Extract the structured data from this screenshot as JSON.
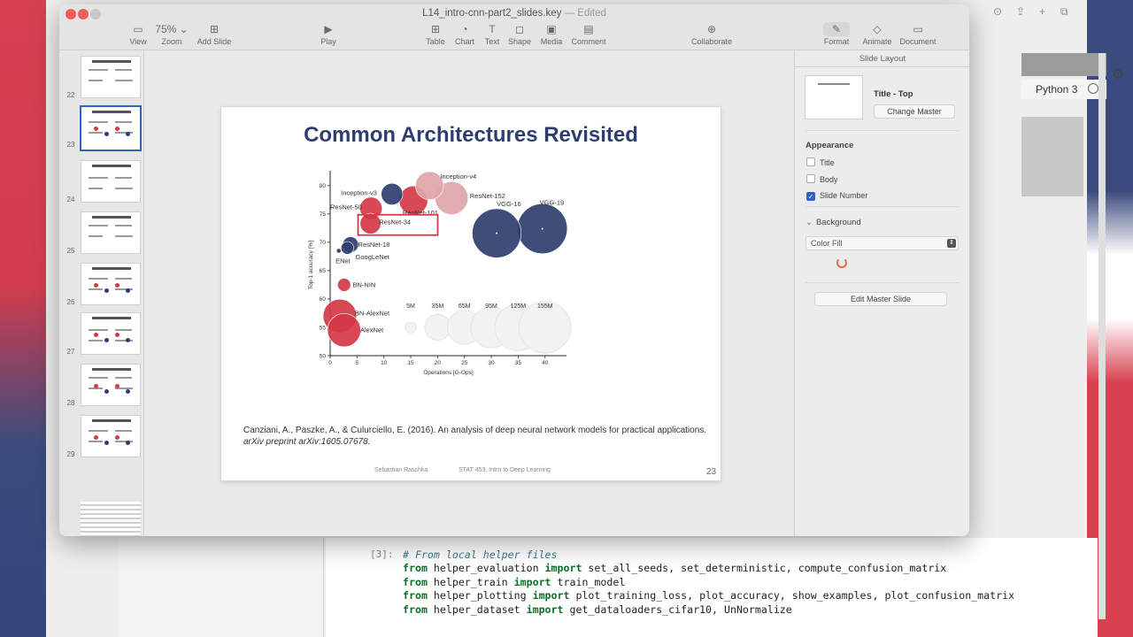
{
  "keynote": {
    "doc_title": "L14_intro-cnn-part2_slides.key",
    "doc_status": "— Edited",
    "toolbar": [
      {
        "name": "view",
        "icon": "▭",
        "label": "View"
      },
      {
        "name": "zoom",
        "icon": "75%  ⌄",
        "label": "Zoom"
      },
      {
        "name": "add-slide",
        "icon": "⊞",
        "label": "Add Slide"
      },
      {
        "name": "play",
        "icon": "▶",
        "label": "Play"
      },
      {
        "name": "table",
        "icon": "⊞",
        "label": "Table"
      },
      {
        "name": "chart",
        "icon": "◔",
        "label": "Chart"
      },
      {
        "name": "text",
        "icon": "T",
        "label": "Text"
      },
      {
        "name": "shape",
        "icon": "◻",
        "label": "Shape"
      },
      {
        "name": "media",
        "icon": "▣",
        "label": "Media"
      },
      {
        "name": "comment",
        "icon": "▤",
        "label": "Comment"
      },
      {
        "name": "collaborate",
        "icon": "⊕",
        "label": "Collaborate"
      },
      {
        "name": "format",
        "icon": "✎",
        "label": "Format"
      },
      {
        "name": "animate",
        "icon": "◇",
        "label": "Animate"
      },
      {
        "name": "document",
        "icon": "▭",
        "label": "Document"
      }
    ],
    "thumbnails": [
      "22",
      "23",
      "24",
      "25",
      "26",
      "27",
      "28",
      "29"
    ],
    "slide": {
      "title": "Common Architectures Revisited",
      "citation_plain": "Canziani, A., Paszke, A., & Culurciello, E. (2016). An analysis of deep neural network models for practical applications.",
      "citation_italic": "arXiv preprint arXiv:1605.07678.",
      "footer_left": "Sebastian Raschka",
      "footer_mid": "STAT 453: Intro to Deep Learning",
      "number": "23"
    },
    "inspector": {
      "header": "Slide Layout",
      "master_name": "Title - Top",
      "change_master": "Change Master",
      "appearance": "Appearance",
      "options": [
        {
          "label": "Title",
          "checked": false
        },
        {
          "label": "Body",
          "checked": false
        },
        {
          "label": "Slide Number",
          "checked": true
        }
      ],
      "background": "Background",
      "fill_type": "Color Fill",
      "edit_master": "Edit Master Slide"
    }
  },
  "jupyter": {
    "kernel": "Python 3",
    "prompt": "[3]:",
    "code": [
      "# From local helper files",
      "from helper_evaluation import set_all_seeds, set_deterministic, compute_confusion_matrix",
      "from helper_train import train_model",
      "from helper_plotting import plot_training_loss, plot_accuracy, show_examples, plot_confusion_matrix",
      "from helper_dataset import get_dataloaders_cifar10, UnNormalize"
    ]
  },
  "chart_data": {
    "type": "scatter",
    "xlabel": "Operations [G-Ops]",
    "ylabel": "Top-1 accuracy [%]",
    "xlim": [
      0,
      44
    ],
    "ylim": [
      50,
      82
    ],
    "xticks": [
      0,
      5,
      10,
      15,
      20,
      25,
      30,
      35,
      40
    ],
    "yticks": [
      50,
      55,
      60,
      65,
      70,
      75,
      80
    ],
    "highlight": "ResNet-34",
    "points": [
      {
        "name": "AlexNet",
        "x": 2.6,
        "y": 54.5,
        "params_m": 61,
        "color": "#d43a45",
        "label_dx": 3.0,
        "label_dy": 0.0
      },
      {
        "name": "BN-AlexNet",
        "x": 1.8,
        "y": 57.0,
        "params_m": 62,
        "color": "#d43a45",
        "label_dx": 2.8,
        "label_dy": 0.5
      },
      {
        "name": "BN-NIN",
        "x": 2.6,
        "y": 62.5,
        "params_m": 7.6,
        "color": "#d43a45",
        "label_dx": 1.6,
        "label_dy": 0.0
      },
      {
        "name": "ENet",
        "x": 1.6,
        "y": 68.5,
        "params_m": 0.4,
        "color": "#2f3e6e",
        "label_dx": -0.6,
        "label_dy": -1.8
      },
      {
        "name": "GoogLeNet",
        "x": 3.2,
        "y": 69.0,
        "params_m": 7.0,
        "color": "#2f3e6e",
        "label_dx": 1.5,
        "label_dy": -1.6
      },
      {
        "name": "ResNet-18",
        "x": 3.8,
        "y": 69.6,
        "params_m": 11.7,
        "color": "#2f3e6e",
        "label_dx": 1.4,
        "label_dy": 0.0
      },
      {
        "name": "ResNet-34",
        "x": 7.5,
        "y": 73.3,
        "params_m": 21.8,
        "color": "#d43a45",
        "label_dx": 1.6,
        "label_dy": 0.3
      },
      {
        "name": "ResNet-50",
        "x": 7.6,
        "y": 76.0,
        "params_m": 25.6,
        "color": "#d43a45",
        "label_dx": -7.6,
        "label_dy": 0.2
      },
      {
        "name": "Inception-v3",
        "x": 11.5,
        "y": 78.5,
        "params_m": 23.8,
        "color": "#2f3e6e",
        "label_dx": -9.5,
        "label_dy": 0.2
      },
      {
        "name": "ResNet-101",
        "x": 15.5,
        "y": 77.4,
        "params_m": 44.5,
        "color": "#d43a45",
        "label_dx": -2.0,
        "label_dy": -2.2
      },
      {
        "name": "Inception-v4",
        "x": 18.5,
        "y": 80.0,
        "params_m": 42.7,
        "color": "#e0a4a8",
        "label_dx": 2.0,
        "label_dy": 1.6
      },
      {
        "name": "ResNet-152",
        "x": 22.6,
        "y": 77.8,
        "params_m": 60.2,
        "color": "#e0a4a8",
        "label_dx": 3.4,
        "label_dy": 0.4
      },
      {
        "name": "VGG-16",
        "x": 31.0,
        "y": 71.6,
        "params_m": 138,
        "color": "#2f3e6e",
        "label_dx": 0.0,
        "label_dy": 5.2
      },
      {
        "name": "VGG-19",
        "x": 39.5,
        "y": 72.4,
        "params_m": 144,
        "color": "#2f3e6e",
        "label_dx": -0.5,
        "label_dy": 4.6
      }
    ],
    "size_legend": [
      {
        "label": "5M",
        "x": 15.0,
        "params_m": 5
      },
      {
        "label": "35M",
        "x": 20.0,
        "params_m": 35
      },
      {
        "label": "65M",
        "x": 25.0,
        "params_m": 65
      },
      {
        "label": "95M",
        "x": 30.0,
        "params_m": 95
      },
      {
        "label": "125M",
        "x": 35.0,
        "params_m": 125
      },
      {
        "label": "155M",
        "x": 40.0,
        "params_m": 155
      }
    ],
    "size_legend_y": 55
  },
  "colors": {
    "accent_blue": "#2f3e6e",
    "accent_red": "#d43a45",
    "selection_blue": "#2f64c2"
  }
}
